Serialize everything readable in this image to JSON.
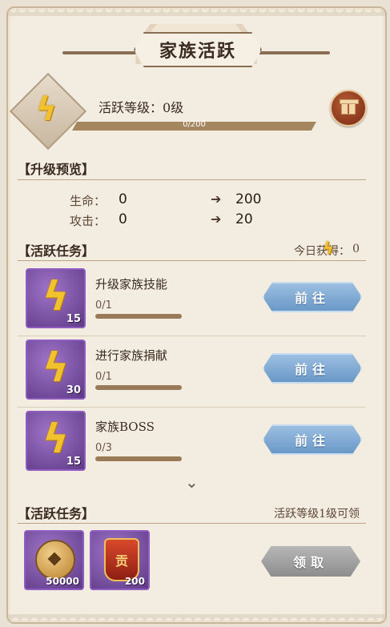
{
  "title": "家族活跃",
  "activity": {
    "level_label": "活跃等级：0级",
    "progress_text": "0/200",
    "progress_fraction": 0
  },
  "upgrade": {
    "section_title": "【升级预览】",
    "stats": [
      {
        "label": "生命：",
        "current": "0",
        "next": "200"
      },
      {
        "label": "攻击：",
        "current": "0",
        "next": "20"
      }
    ]
  },
  "tasks": {
    "section_title": "【活跃任务】",
    "today_label": "今日获得：",
    "today_value": "0",
    "items": [
      {
        "name": "升级家族技能",
        "progress": "0/1",
        "reward": "15",
        "button": "前往"
      },
      {
        "name": "进行家族捐献",
        "progress": "0/1",
        "reward": "30",
        "button": "前往"
      },
      {
        "name": "家族BOSS",
        "progress": "0/3",
        "reward": "15",
        "button": "前往"
      }
    ]
  },
  "rewards": {
    "section_title": "【活跃任务】",
    "requirement": "活跃等级1级可领",
    "items": [
      {
        "icon": "coin-icon",
        "amount": "50000"
      },
      {
        "icon": "token-icon",
        "amount": "200",
        "glyph": "贡"
      }
    ],
    "claim_button": "领取"
  },
  "colors": {
    "bolt": "#f2c12e",
    "blue_button": "#6796c6",
    "gray_button": "#8d8d8d",
    "item_frame": "#8f5cc0"
  }
}
